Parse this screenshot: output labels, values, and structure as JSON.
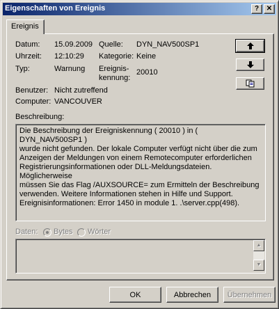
{
  "window": {
    "title": "Eigenschaften von Ereignis"
  },
  "titlebar": {
    "help": "?",
    "close": "✕"
  },
  "tab": {
    "label": "Ereignis"
  },
  "fields": {
    "datum_label": "Datum:",
    "datum_value": "15.09.2009",
    "uhrzeit_label": "Uhrzeit:",
    "uhrzeit_value": "12:10:29",
    "typ_label": "Typ:",
    "typ_value": "Warnung",
    "benutzer_label": "Benutzer:",
    "benutzer_value": "Nicht zutreffend",
    "computer_label": "Computer:",
    "computer_value": "VANCOUVER",
    "quelle_label": "Quelle:",
    "quelle_value": "DYN_NAV500SP1",
    "kategorie_label": "Kategorie:",
    "kategorie_value": "Keine",
    "kennung_label_1": "Ereignis-",
    "kennung_label_2": "kennung:",
    "kennung_value": "20010"
  },
  "description": {
    "label": "Beschreibung:",
    "lines": [
      "Die Beschreibung der Ereigniskennung ( 20010 ) in ( DYN_NAV500SP1 )",
      "wurde nicht gefunden. Der lokale Computer verfügt nicht über die zum",
      "Anzeigen der Meldungen von einem Remotecomputer erforderlichen",
      "Registrierungsinformationen oder DLL-Meldungsdateien. Möglicherweise",
      "müssen Sie das Flag /AUXSOURCE= zum Ermitteln der Beschreibung",
      "verwenden. Weitere Informationen stehen in Hilfe und Support.",
      "Ereignisinformationen: Error 1450 in module 1. .\\server.cpp(498)."
    ]
  },
  "data_section": {
    "label": "Daten:",
    "bytes": "Bytes",
    "words": "Wörter"
  },
  "nav_icons": {
    "up": "arrow-up-icon",
    "down": "arrow-down-icon",
    "copy": "copy-icon"
  },
  "buttons": {
    "ok": "OK",
    "cancel": "Abbrechen",
    "apply": "Übernehmen"
  }
}
